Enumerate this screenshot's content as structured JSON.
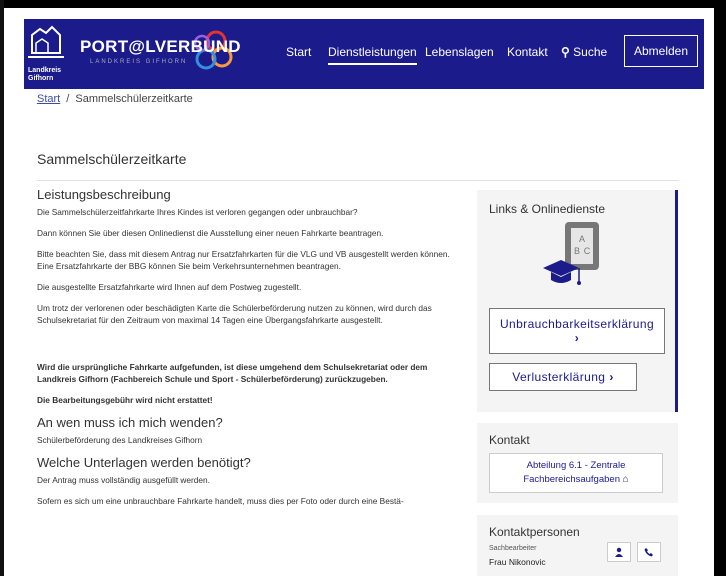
{
  "header": {
    "logo_text_line1": "Landkreis",
    "logo_text_line2": "Gifhorn",
    "portal_name": "PORT@LVERBUND",
    "portal_sub": "LANDKREIS GIFHORN",
    "nav": [
      "Start",
      "Dienstleistungen",
      "Lebenslagen",
      "Kontakt"
    ],
    "search_label": "Suche",
    "logout_label": "Abmelden"
  },
  "breadcrumb": {
    "home": "Start",
    "separator": "/",
    "current": "Sammelschülerzeitkarte"
  },
  "page_title": "Sammelschülerzeitkarte",
  "main": {
    "section1_heading": "Leistungsbeschreibung",
    "p1": "Die Sammelschülerzeitfahrkarte Ihres Kindes ist verloren gegangen oder unbrauchbar?",
    "p2": "Dann können Sie über diesen Onlinedienst die Ausstellung einer neuen Fahrkarte beantragen.",
    "p3": "Bitte beachten Sie, dass mit diesem Antrag nur Ersatzfahrkarten für die VLG und VB ausgestellt werden können. Eine Ersatzfahrkarte der BBG können Sie beim Verkehrsunternehmen beantragen.",
    "p4": "Die ausgestellte Ersatzfahrkarte wird Ihnen auf dem Postweg zugestellt.",
    "p5": "Um trotz der verlorenen oder beschädigten Karte die Schülerbeförderung nutzen zu können, wird durch das Schulsekretariat für den Zeitraum von maximal 14 Tagen eine Übergangsfahrkarte ausgestellt.",
    "p6": "Wird die ursprüngliche Fahrkarte aufgefunden, ist diese umgehend dem Schulsekretariat oder dem Landkreis Gifhorn (Fachbereich Schule und Sport - Schülerbeförderung) zurückzugeben.",
    "p7": "Die Bearbeitungsgebühr wird nicht erstattet!",
    "section2_heading": "An wen muss ich mich wenden?",
    "p8": "Schülerbeförderung des Landkreises Gifhorn",
    "section3_heading": "Welche Unterlagen werden benötigt?",
    "p9": "Der Antrag muss vollständig ausgefüllt werden.",
    "p10": "Sofern es sich um eine unbrauchbare Fahrkarte handelt, muss dies per Foto oder durch eine Bestä-"
  },
  "sidebar": {
    "title": "Links & Onlinedienste",
    "icon_letters": [
      "A",
      "B",
      "C"
    ],
    "btn1_line1": "Unbrauchbarkeitserklärung",
    "btn2": "Verlusterklärung",
    "chevron": "›"
  },
  "contact": {
    "title": "Kontakt",
    "line1": "Abteilung 6.1 - Zentrale",
    "line2": "Fachbereichsaufgaben"
  },
  "persons": {
    "title": "Kontaktpersonen",
    "role": "Sachbearbeiter",
    "name": "Frau Nikonovic"
  },
  "colors": {
    "brand": "#1b1b8c",
    "accent_red": "#e3342f",
    "accent_orange": "#f6993f"
  }
}
